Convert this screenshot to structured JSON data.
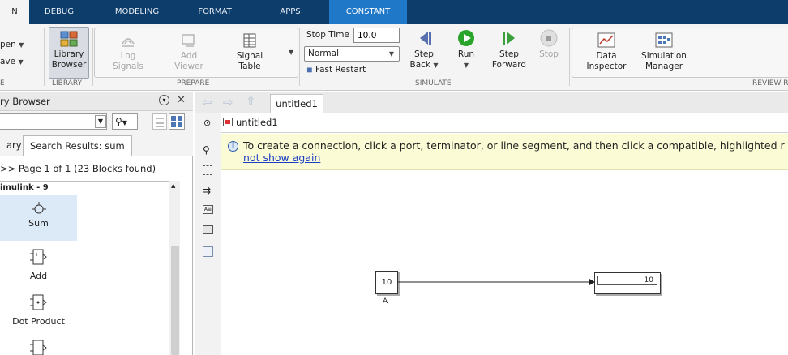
{
  "tabs": [
    {
      "label": "N"
    },
    {
      "label": "DEBUG"
    },
    {
      "label": "MODELING"
    },
    {
      "label": "FORMAT"
    },
    {
      "label": "APPS"
    },
    {
      "label": "CONSTANT"
    }
  ],
  "ribbon": {
    "file": {
      "open": "pen",
      "save": "ave",
      "section": "E"
    },
    "library": {
      "button": [
        "Library",
        "Browser"
      ],
      "section": "LIBRARY"
    },
    "prepare": {
      "log_signals": [
        "Log",
        "Signals"
      ],
      "add_viewer": [
        "Add",
        "Viewer"
      ],
      "signal_table": [
        "Signal",
        "Table"
      ],
      "section": "PREPARE"
    },
    "simulate": {
      "stop_time_label": "Stop Time",
      "stop_time_value": "10.0",
      "mode": "Normal",
      "fast_restart": "Fast Restart",
      "step_back": [
        "Step",
        "Back"
      ],
      "run": "Run",
      "step_forward": [
        "Step",
        "Forward"
      ],
      "stop": "Stop",
      "section": "SIMULATE"
    },
    "review": {
      "data_inspector": [
        "Data",
        "Inspector"
      ],
      "simulation_manager": [
        "Simulation",
        "Manager"
      ],
      "section": "REVIEW R"
    }
  },
  "library_browser": {
    "title": "ry Browser",
    "tabs": [
      "ary",
      "Search Results: sum"
    ],
    "pager": ">> Page 1 of 1 (23 Blocks found)",
    "group": "imulink - 9",
    "blocks": [
      "Sum",
      "Add",
      "Dot Product"
    ]
  },
  "editor": {
    "tab": "untitled1",
    "breadcrumb": "untitled1",
    "notice": "To create a connection, click a port, terminator, or line segment, and then click a compatible, highlighted r",
    "notice_link": "not show again "
  },
  "model": {
    "constant_value": "10",
    "constant_label": "A",
    "display_value": "10"
  },
  "colors": {
    "tabstrip": "#0d3d6b",
    "constant_tab": "#1f78c8",
    "notice": "#fbfbd5",
    "run": "#2aa42a"
  }
}
